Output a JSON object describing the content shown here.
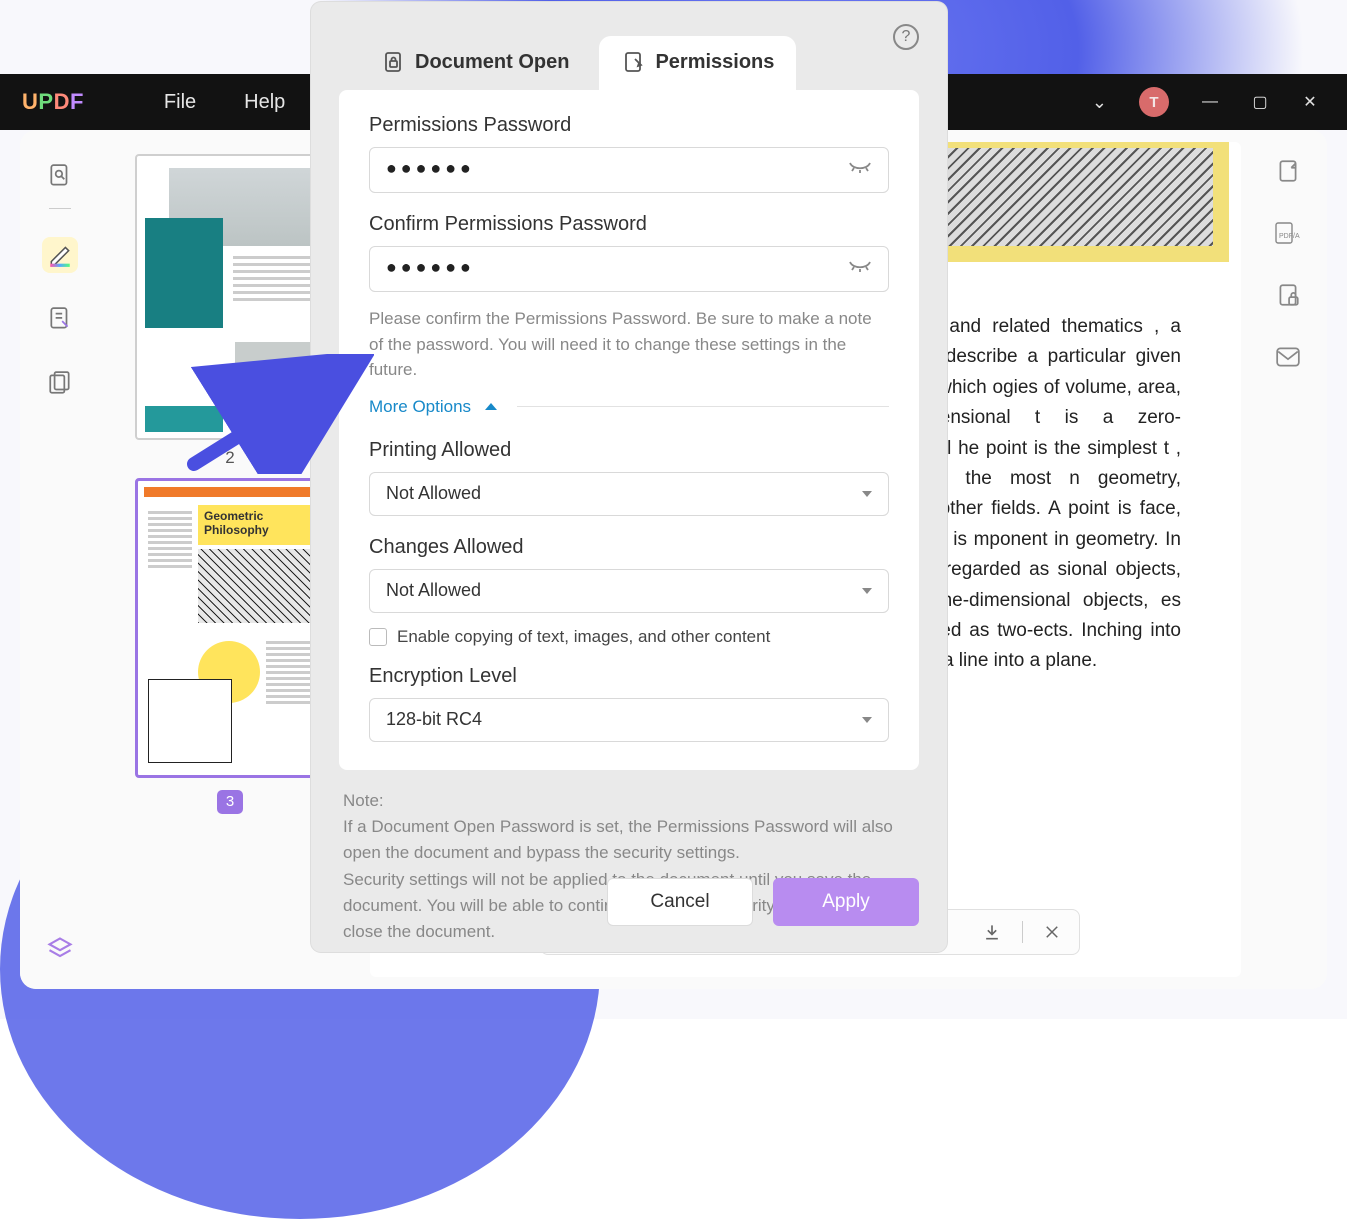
{
  "app": {
    "logo_chars": [
      "U",
      "P",
      "D",
      "F"
    ],
    "menus": {
      "file": "File",
      "help": "Help"
    },
    "avatar_initial": "T"
  },
  "thumbs": {
    "page2_number": "2",
    "page3_number": "3",
    "page3_title": "Geometric Philosophy"
  },
  "document": {
    "body_snippet": "topology , and related thematics , a point in a describe a particular given space , in which ogies of volume, area, higher-dimensional t is a zero-dimensional he point is the simplest t , usually as the most n geometry, physics, l other fields. A point is face, and a point is mponent in geometry. In points are regarded as sional objects, lines are ne-dimensional objects, es are regarded as two-ects. Inching into a line, and a line into a plane."
  },
  "modal": {
    "tabs": {
      "doc_open": "Document Open",
      "permissions": "Permissions",
      "active": "permissions"
    },
    "permissions_password_label": "Permissions Password",
    "permissions_password_value": "●●●●●●",
    "confirm_password_label": "Confirm Permissions Password",
    "confirm_password_value": "●●●●●●",
    "confirm_helper": "Please confirm the Permissions Password. Be sure to make a note of the password. You will need it to change these settings in the future.",
    "more_options_label": "More Options",
    "printing_label": "Printing Allowed",
    "printing_value": "Not Allowed",
    "changes_label": "Changes Allowed",
    "changes_value": "Not Allowed",
    "enable_copying_label": "Enable copying of text, images, and other content",
    "enable_copying_checked": false,
    "encryption_label": "Encryption Level",
    "encryption_value": "128-bit RC4",
    "note_heading": "Note:",
    "note_body": "If a Document Open Password is set, the Permissions Password will also open the document and bypass the security settings.\nSecurity settings will not be applied to the document until you save the document. You will be able to continue to change security settings until you close the document.",
    "cancel_label": "Cancel",
    "apply_label": "Apply"
  }
}
